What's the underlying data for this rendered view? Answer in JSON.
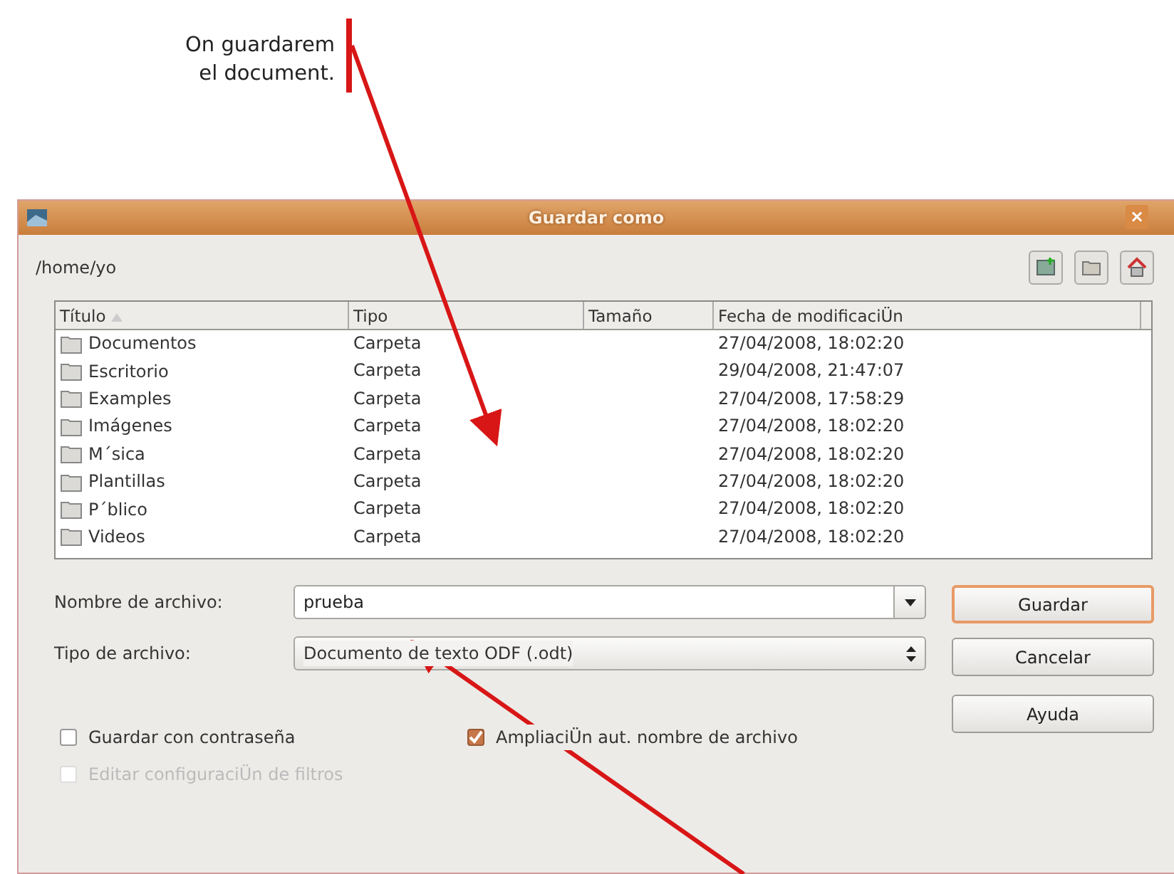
{
  "annotation": {
    "lines": [
      "On guardarem",
      "el document."
    ]
  },
  "window": {
    "title": "Guardar como",
    "close": "×"
  },
  "location": {
    "path": "/home/yo"
  },
  "file_list": {
    "columns": [
      "Título",
      "Tipo",
      "Tamaño",
      "Fecha de modificaciÜn"
    ],
    "rows": [
      {
        "name": "Documentos",
        "type": "Carpeta",
        "size": "",
        "modified": "27/04/2008, 18:02:20"
      },
      {
        "name": "Escritorio",
        "type": "Carpeta",
        "size": "",
        "modified": "29/04/2008, 21:47:07"
      },
      {
        "name": "Examples",
        "type": "Carpeta",
        "size": "",
        "modified": "27/04/2008, 17:58:29"
      },
      {
        "name": "Imágenes",
        "type": "Carpeta",
        "size": "",
        "modified": "27/04/2008, 18:02:20"
      },
      {
        "name": "M´sica",
        "type": "Carpeta",
        "size": "",
        "modified": "27/04/2008, 18:02:20"
      },
      {
        "name": "Plantillas",
        "type": "Carpeta",
        "size": "",
        "modified": "27/04/2008, 18:02:20"
      },
      {
        "name": "P´blico",
        "type": "Carpeta",
        "size": "",
        "modified": "27/04/2008, 18:02:20"
      },
      {
        "name": "Videos",
        "type": "Carpeta",
        "size": "",
        "modified": "27/04/2008, 18:02:20"
      }
    ]
  },
  "filename": {
    "label": "Nombre de archivo:",
    "value": "prueba"
  },
  "filetype": {
    "label": "Tipo de archivo:",
    "value": "Documento de texto ODF (.odt)"
  },
  "buttons": [
    {
      "label": "Guardar",
      "default": true
    },
    {
      "label": "Cancelar",
      "default": false
    },
    {
      "label": "Ayuda",
      "default": false
    }
  ],
  "options": [
    {
      "label": "Guardar con contraseña",
      "checked": false,
      "disabled": false
    },
    {
      "label": "AmpliaciÜn aut. nombre de archivo",
      "checked": true,
      "disabled": false
    },
    {
      "label": "Editar configuraciÜn de filtros",
      "checked": false,
      "disabled": true
    }
  ]
}
